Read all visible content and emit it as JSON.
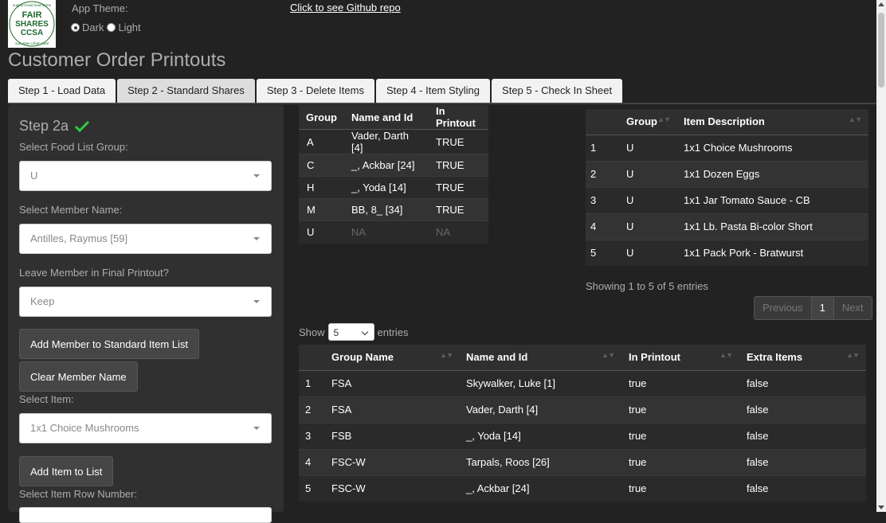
{
  "logo": {
    "line1": "FAIR",
    "line2": "SHARES",
    "line3": "CCSA",
    "ring_top": "support local food farms",
    "ring_bottom": "suburban urban rural"
  },
  "theme": {
    "label": "App Theme:",
    "options": [
      "Dark",
      "Light"
    ],
    "selected": "Dark"
  },
  "github_link": "Click to see Github repo",
  "page_title": "Customer Order Printouts",
  "tabs": [
    {
      "label": "Step 1 - Load Data"
    },
    {
      "label": "Step 2 - Standard Shares"
    },
    {
      "label": "Step 3 - Delete Items"
    },
    {
      "label": "Step 4 - Item Styling"
    },
    {
      "label": "Step 5 - Check In Sheet"
    }
  ],
  "sidebar": {
    "step_title": "Step 2a",
    "food_group_label": "Select Food List Group:",
    "food_group_value": "U",
    "member_label": "Select Member Name:",
    "member_value": "Antilles, Raymus [59]",
    "leave_label": "Leave Member in Final Printout?",
    "leave_value": "Keep",
    "add_member_button": "Add Member to Standard Item List",
    "clear_member_button": "Clear Member Name",
    "item_label": "Select Item:",
    "item_value": "1x1 Choice Mushrooms",
    "add_item_button": "Add Item to List",
    "row_number_label": "Select Item Row Number:"
  },
  "group_table": {
    "headers": [
      "Group",
      "Name and Id",
      "In Printout"
    ],
    "rows": [
      [
        "A",
        "Vader, Darth [4]",
        "TRUE"
      ],
      [
        "C",
        "_, Ackbar [24]",
        "TRUE"
      ],
      [
        "H",
        "_, Yoda [14]",
        "TRUE"
      ],
      [
        "M",
        "BB, 8_ [34]",
        "TRUE"
      ],
      [
        "U",
        "NA",
        "NA"
      ]
    ]
  },
  "item_table": {
    "headers": [
      "",
      "Group",
      "Item Description"
    ],
    "rows": [
      [
        "1",
        "U",
        "1x1 Choice Mushrooms"
      ],
      [
        "2",
        "U",
        "1x1 Dozen Eggs"
      ],
      [
        "3",
        "U",
        "1x1 Jar Tomato Sauce - CB"
      ],
      [
        "4",
        "U",
        "1x1 Lb. Pasta Bi-color Short"
      ],
      [
        "5",
        "U",
        "1x1 Pack Pork - Bratwurst"
      ]
    ],
    "info": "Showing 1 to 5 of 5 entries",
    "pager": {
      "previous": "Previous",
      "page": "1",
      "next": "Next"
    }
  },
  "member_table": {
    "show_label": "Show",
    "show_value": "5",
    "entries_label": "entries",
    "headers": [
      "",
      "Group Name",
      "Name and Id",
      "In Printout",
      "Extra Items"
    ],
    "rows": [
      [
        "1",
        "FSA",
        "Skywalker, Luke [1]",
        "true",
        "false"
      ],
      [
        "2",
        "FSA",
        "Vader, Darth [4]",
        "true",
        "false"
      ],
      [
        "3",
        "FSB",
        "_, Yoda [14]",
        "true",
        "false"
      ],
      [
        "4",
        "FSC-W",
        "Tarpals, Roos [26]",
        "true",
        "false"
      ],
      [
        "5",
        "FSC-W",
        "_, Ackbar [24]",
        "true",
        "false"
      ]
    ]
  },
  "colors": {
    "background": "#222222",
    "panel": "#303030",
    "check": "#2ecc40"
  }
}
